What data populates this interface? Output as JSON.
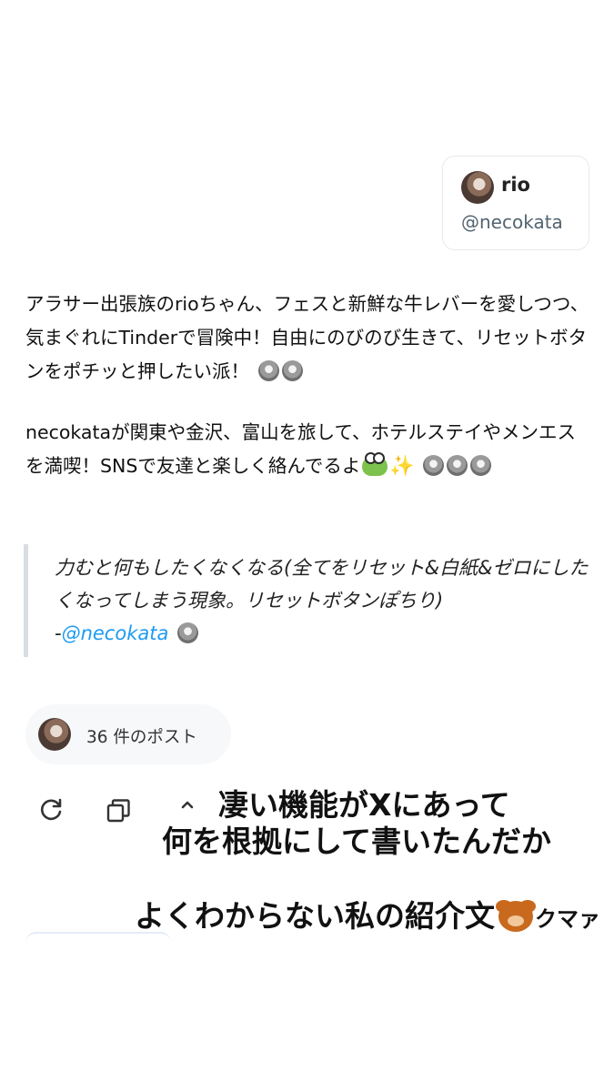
{
  "profile": {
    "name": "rio",
    "handle": "@necokata"
  },
  "bio": {
    "paragraph1": "アラサー出張族のrioちゃん、フェスと新鮮な牛レバーを愛しつつ、気まぐれにTinderで冒険中！自由にのびのび生きて、リセットボタンをポチッと押したい派！",
    "paragraph2": "necokataが関東や金沢、富山を旅して、ホテルステイやメンエスを満喫！SNSで友達と楽しく絡んでるよ"
  },
  "quote": {
    "text": "力むと何もしたくなくなる(全てをリセット&白紙&ゼロにしたくなってしまう現象。リセットボタンぽちり)",
    "dash": "-",
    "link": "@necokata"
  },
  "posts": {
    "count_label": "36 件のポスト"
  },
  "caption": {
    "line1": "凄い機能がXにあって",
    "line2": "何を根拠にして書いたんだか",
    "line3": "よくわからない私の紹介文",
    "suffix": "クマァ"
  },
  "icons": {
    "refresh": "refresh-icon",
    "copy": "copy-icon",
    "up": "chevron-up-icon",
    "emoji_face": "face-emoji-icon",
    "emoji_frog": "frog-emoji-icon",
    "emoji_sparkle": "sparkles-emoji-icon",
    "emoji_bear": "bear-emoji-icon"
  },
  "colors": {
    "link": "#1d9bf0",
    "quote_border": "#d9dde3",
    "pill_bg": "#f6f8fa"
  }
}
